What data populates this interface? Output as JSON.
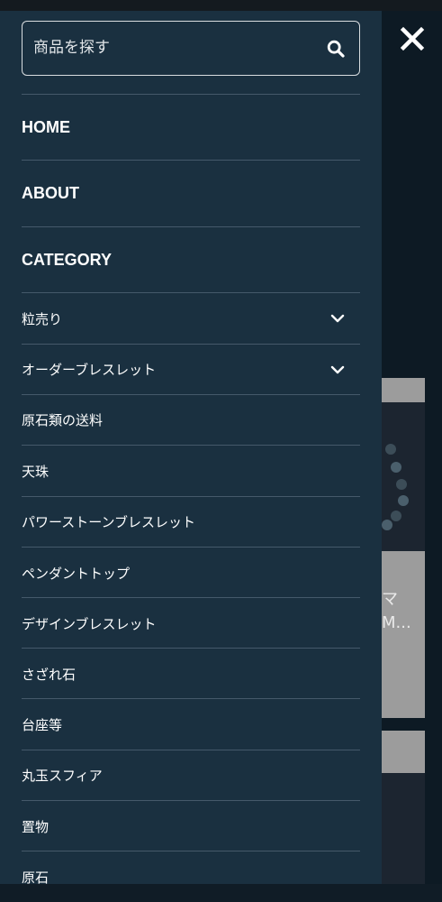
{
  "search": {
    "placeholder": "商品を探す"
  },
  "nav": {
    "items": [
      {
        "label": "HOME"
      },
      {
        "label": "ABOUT"
      },
      {
        "label": "CATEGORY"
      }
    ]
  },
  "categories": [
    {
      "label": "粒売り",
      "expandable": true
    },
    {
      "label": "オーダーブレスレット",
      "expandable": true
    },
    {
      "label": "原石類の送料",
      "expandable": false
    },
    {
      "label": "天珠",
      "expandable": false
    },
    {
      "label": "パワーストーンブレスレット",
      "expandable": false
    },
    {
      "label": "ペンダントトップ",
      "expandable": false
    },
    {
      "label": "デザインブレスレット",
      "expandable": false
    },
    {
      "label": "さざれ石",
      "expandable": false
    },
    {
      "label": "台座等",
      "expandable": false
    },
    {
      "label": "丸玉スフィア",
      "expandable": false
    },
    {
      "label": "置物",
      "expandable": false
    },
    {
      "label": "原石",
      "expandable": false
    }
  ],
  "background_page": {
    "text_line1": "マ",
    "text_line2": "M..."
  },
  "icons": {
    "search": "search-icon",
    "close": "close-icon",
    "chevron": "chevron-down-icon"
  },
  "colors": {
    "drawer_bg": "#1a3040",
    "divider": "#45596a",
    "text": "#ffffff"
  }
}
